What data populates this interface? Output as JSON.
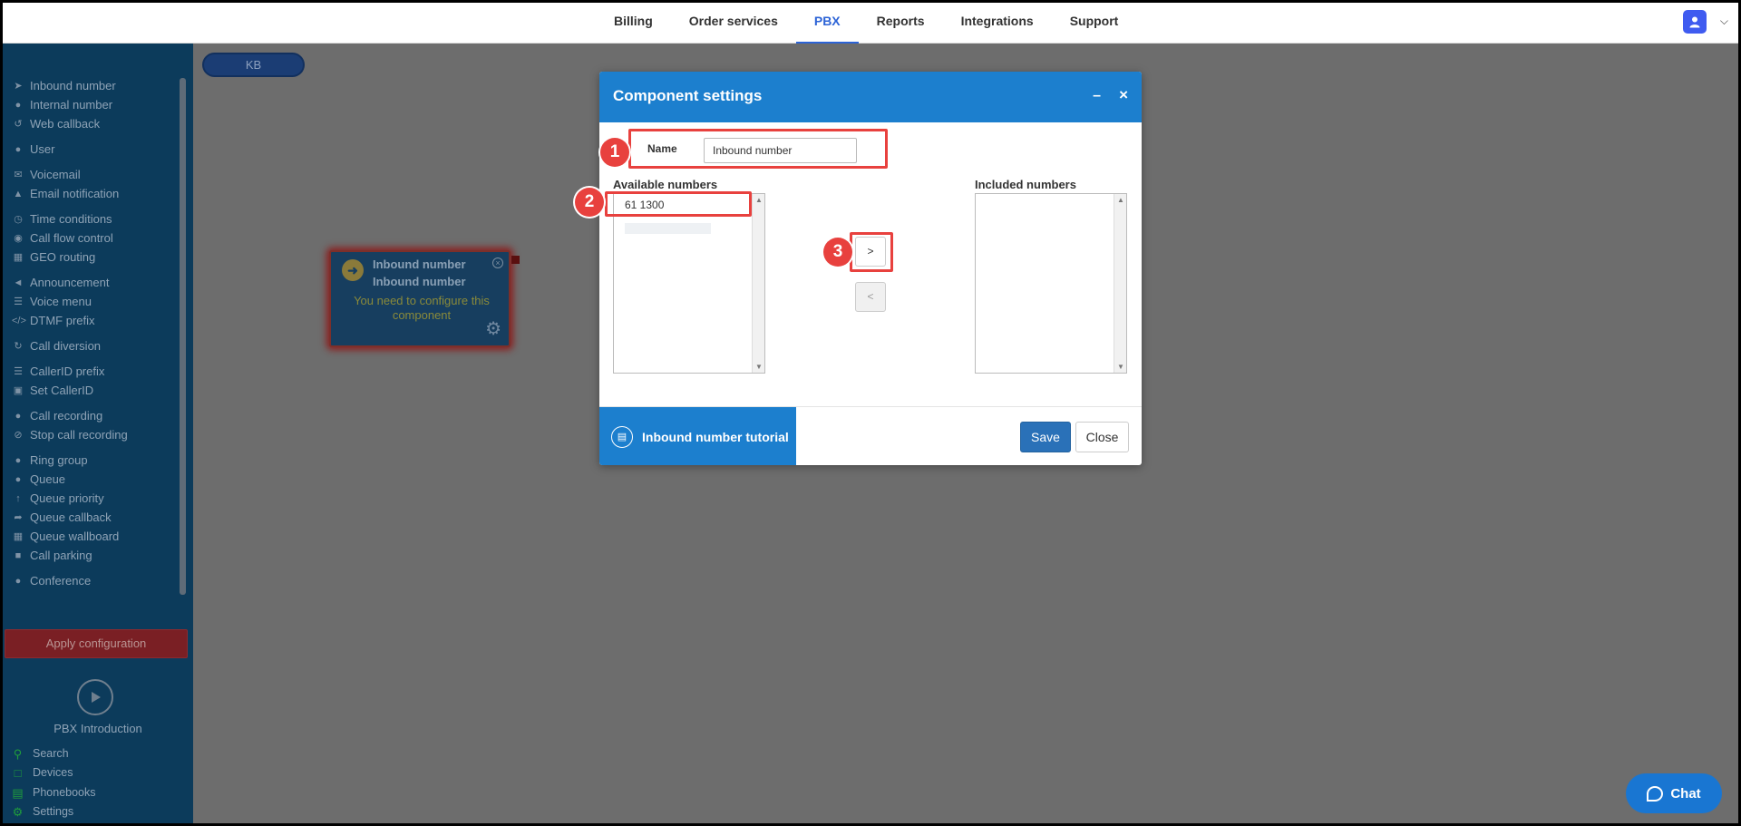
{
  "topnav": {
    "items": [
      "Billing",
      "Order services",
      "PBX",
      "Reports",
      "Integrations",
      "Support"
    ],
    "active": "PBX"
  },
  "sidebar": {
    "items": [
      {
        "label": "Inbound number",
        "icon": "arrow-circle-icon"
      },
      {
        "label": "Internal number",
        "icon": "map-pin-icon"
      },
      {
        "label": "Web callback",
        "icon": "undo-icon"
      },
      {
        "label": "User",
        "icon": "user-icon"
      },
      {
        "label": "Voicemail",
        "icon": "envelope-icon"
      },
      {
        "label": "Email notification",
        "icon": "bell-icon"
      },
      {
        "label": "Time conditions",
        "icon": "clock-icon"
      },
      {
        "label": "Call flow control",
        "icon": "toggle-icon"
      },
      {
        "label": "GEO routing",
        "icon": "sitemap-icon"
      },
      {
        "label": "Announcement",
        "icon": "megaphone-icon"
      },
      {
        "label": "Voice menu",
        "icon": "list-icon"
      },
      {
        "label": "DTMF prefix",
        "icon": "code-icon"
      },
      {
        "label": "Call diversion",
        "icon": "redo-icon"
      },
      {
        "label": "CallerID prefix",
        "icon": "list-icon"
      },
      {
        "label": "Set CallerID",
        "icon": "id-card-icon"
      },
      {
        "label": "Call recording",
        "icon": "microphone-icon"
      },
      {
        "label": "Stop call recording",
        "icon": "microphone-slash-icon"
      },
      {
        "label": "Ring group",
        "icon": "users-icon"
      },
      {
        "label": "Queue",
        "icon": "user-plus-icon"
      },
      {
        "label": "Queue priority",
        "icon": "arrow-up-icon"
      },
      {
        "label": "Queue callback",
        "icon": "share-icon"
      },
      {
        "label": "Queue wallboard",
        "icon": "table-icon"
      },
      {
        "label": "Call parking",
        "icon": "parking-icon"
      },
      {
        "label": "Conference",
        "icon": "comments-icon"
      }
    ],
    "apply_label": "Apply configuration",
    "intro_label": "PBX Introduction",
    "bottom_links": [
      "Search",
      "Devices",
      "Phonebooks",
      "Settings"
    ]
  },
  "canvas": {
    "kb_label": "KB",
    "node": {
      "title_line1": "Inbound number",
      "title_line2": "Inbound number",
      "message": "You need to configure this component"
    }
  },
  "dialog": {
    "title": "Component settings",
    "name_label": "Name",
    "name_value": "Inbound number",
    "available_label": "Available numbers",
    "included_label": "Included numbers",
    "available_options": [
      "61 1300"
    ],
    "move_right_label": ">",
    "move_left_label": "<",
    "tutorial_label": "Inbound number tutorial",
    "save_label": "Save",
    "close_label": "Close"
  },
  "annotations": {
    "badge1": "1",
    "badge2": "2",
    "badge3": "3"
  },
  "chat": {
    "label": "Chat"
  },
  "colors": {
    "accent": "#1c7fce",
    "highlight": "#e8413e",
    "nav_active": "#2c63d6"
  }
}
